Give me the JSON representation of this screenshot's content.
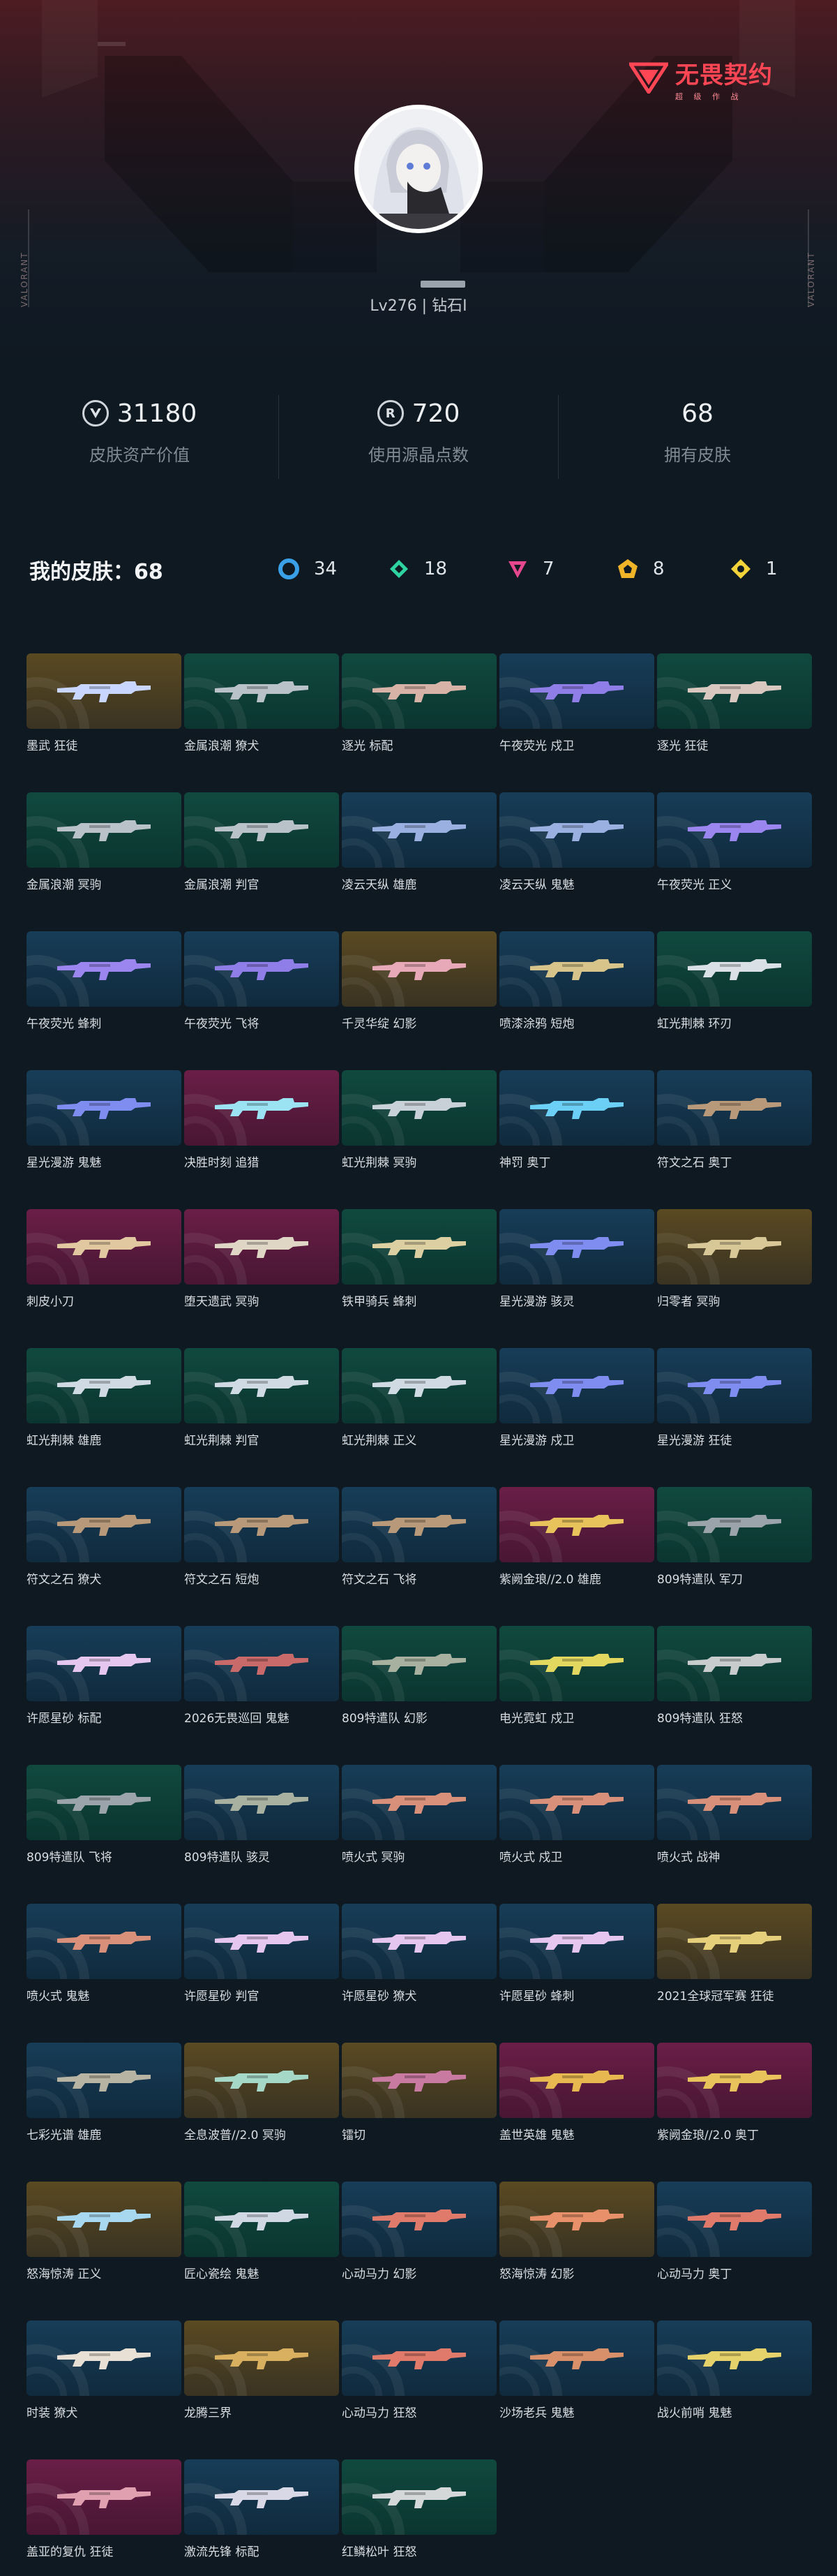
{
  "header": {
    "logo_title": "无畏契约",
    "logo_subtitle": "超 级 作 战",
    "side_left": "VALORANT",
    "side_right": "VALORANT",
    "level_text": "Lv276 | 钻石I"
  },
  "stats": [
    {
      "value": "31180",
      "label": "皮肤资产价值",
      "icon": "valorant-points-icon"
    },
    {
      "value": "720",
      "label": "使用源晶点数",
      "icon": "radianite-icon"
    },
    {
      "value": "68",
      "label": "拥有皮肤",
      "icon": ""
    }
  ],
  "summary": {
    "title": "我的皮肤：68",
    "tiers": [
      {
        "icon": "select-tier-icon",
        "color": "#3aa0e8",
        "count": "34"
      },
      {
        "icon": "deluxe-tier-icon",
        "color": "#2ed3a0",
        "count": "18"
      },
      {
        "icon": "premium-tier-icon",
        "color": "#e6488f",
        "count": "7"
      },
      {
        "icon": "ultra-tier-icon",
        "color": "#f0b429",
        "count": "8"
      },
      {
        "icon": "exclusive-tier-icon",
        "color": "#f2d33a",
        "count": "1"
      }
    ]
  },
  "skins": [
    {
      "name": "墨武 狂徒",
      "tier": "gold",
      "gun_color": "#c9d6ff"
    },
    {
      "name": "金属浪潮 獠犬",
      "tier": "green",
      "gun_color": "#b8c2c8"
    },
    {
      "name": "逐光 标配",
      "tier": "green",
      "gun_color": "#d7b2a6"
    },
    {
      "name": "午夜荧光 戍卫",
      "tier": "blue",
      "gun_color": "#8f7ee8"
    },
    {
      "name": "逐光 狂徒",
      "tier": "green",
      "gun_color": "#d8c8c0"
    },
    {
      "name": "金属浪潮 冥驹",
      "tier": "green",
      "gun_color": "#b8c2c8"
    },
    {
      "name": "金属浪潮 判官",
      "tier": "green",
      "gun_color": "#b8c2c8"
    },
    {
      "name": "凌云天纵 雄鹿",
      "tier": "blue",
      "gun_color": "#9ab0e0"
    },
    {
      "name": "凌云天纵 鬼魅",
      "tier": "blue",
      "gun_color": "#9ab0e0"
    },
    {
      "name": "午夜荧光 正义",
      "tier": "blue",
      "gun_color": "#9b86f0"
    },
    {
      "name": "午夜荧光 蜂刺",
      "tier": "blue",
      "gun_color": "#9b86f0"
    },
    {
      "name": "午夜荧光 飞将",
      "tier": "blue",
      "gun_color": "#8f7ee8"
    },
    {
      "name": "千灵华绽 幻影",
      "tier": "gold",
      "gun_color": "#e7a8b8"
    },
    {
      "name": "喷漆涂鸦 短炮",
      "tier": "blue",
      "gun_color": "#d6c48a"
    },
    {
      "name": "虹光荆棘 环刃",
      "tier": "green",
      "gun_color": "#d9e0e6"
    },
    {
      "name": "星光漫游 鬼魅",
      "tier": "blue",
      "gun_color": "#7f8cf0"
    },
    {
      "name": "决胜时刻 追猎",
      "tier": "pink",
      "gun_color": "#9be3f2"
    },
    {
      "name": "虹光荆棘 冥驹",
      "tier": "green",
      "gun_color": "#c8d0d8"
    },
    {
      "name": "神罚 奥丁",
      "tier": "blue",
      "gun_color": "#6ccff5"
    },
    {
      "name": "符文之石 奥丁",
      "tier": "blue",
      "gun_color": "#b89a7a"
    },
    {
      "name": "刺皮小刀",
      "tier": "pink",
      "gun_color": "#e2c8a0"
    },
    {
      "name": "堕天遗武 冥驹",
      "tier": "pink",
      "gun_color": "#e0d6c6"
    },
    {
      "name": "铁甲骑兵 蜂刺",
      "tier": "green",
      "gun_color": "#dccfa2"
    },
    {
      "name": "星光漫游 骇灵",
      "tier": "blue",
      "gun_color": "#7f8cf0"
    },
    {
      "name": "归零者 冥驹",
      "tier": "gold",
      "gun_color": "#d8c898"
    },
    {
      "name": "虹光荆棘 雄鹿",
      "tier": "green",
      "gun_color": "#d0dae2"
    },
    {
      "name": "虹光荆棘 判官",
      "tier": "green",
      "gun_color": "#d0dae2"
    },
    {
      "name": "虹光荆棘 正义",
      "tier": "green",
      "gun_color": "#d0dae2"
    },
    {
      "name": "星光漫游 戍卫",
      "tier": "blue",
      "gun_color": "#7f8cf0"
    },
    {
      "name": "星光漫游 狂徒",
      "tier": "blue",
      "gun_color": "#7f8cf0"
    },
    {
      "name": "符文之石 獠犬",
      "tier": "blue",
      "gun_color": "#b89a7a"
    },
    {
      "name": "符文之石 短炮",
      "tier": "blue",
      "gun_color": "#b89a7a"
    },
    {
      "name": "符文之石 飞将",
      "tier": "blue",
      "gun_color": "#b89a7a"
    },
    {
      "name": "紫阙金琅//2.0 雄鹿",
      "tier": "pink",
      "gun_color": "#e8c25a"
    },
    {
      "name": "809特遣队 军刀",
      "tier": "green",
      "gun_color": "#9aa4aa"
    },
    {
      "name": "许愿星砂 标配",
      "tier": "blue",
      "gun_color": "#e4c6ee"
    },
    {
      "name": "2026无畏巡回 鬼魅",
      "tier": "blue",
      "gun_color": "#c86a6a"
    },
    {
      "name": "809特遣队 幻影",
      "tier": "green",
      "gun_color": "#a8b0a0"
    },
    {
      "name": "电光霓虹 戍卫",
      "tier": "green",
      "gun_color": "#e2d860"
    },
    {
      "name": "809特遣队 狂怒",
      "tier": "green",
      "gun_color": "#c8cccc"
    },
    {
      "name": "809特遣队 飞将",
      "tier": "green",
      "gun_color": "#9aa4aa"
    },
    {
      "name": "809特遣队 骇灵",
      "tier": "blue",
      "gun_color": "#a8b0a0"
    },
    {
      "name": "喷火式 冥驹",
      "tier": "blue",
      "gun_color": "#d8907a"
    },
    {
      "name": "喷火式 戍卫",
      "tier": "blue",
      "gun_color": "#d8907a"
    },
    {
      "name": "喷火式 战神",
      "tier": "blue",
      "gun_color": "#d8907a"
    },
    {
      "name": "喷火式 鬼魅",
      "tier": "blue",
      "gun_color": "#d8907a"
    },
    {
      "name": "许愿星砂 判官",
      "tier": "blue",
      "gun_color": "#e4c6ee"
    },
    {
      "name": "许愿星砂 獠犬",
      "tier": "blue",
      "gun_color": "#e4c6ee"
    },
    {
      "name": "许愿星砂 蜂刺",
      "tier": "blue",
      "gun_color": "#e4c6ee"
    },
    {
      "name": "2021全球冠军赛 狂徒",
      "tier": "gold",
      "gun_color": "#e6cf7a"
    },
    {
      "name": "七彩光谱 雄鹿",
      "tier": "blue",
      "gun_color": "#b8b4a4"
    },
    {
      "name": "全息波普//2.0 冥驹",
      "tier": "gold",
      "gun_color": "#a6d8c8"
    },
    {
      "name": "镭切",
      "tier": "gold",
      "gun_color": "#c87aa0"
    },
    {
      "name": "盖世英雄 鬼魅",
      "tier": "pink",
      "gun_color": "#e8b850"
    },
    {
      "name": "紫阙金琅//2.0 奥丁",
      "tier": "pink",
      "gun_color": "#e8c25a"
    },
    {
      "name": "怒海惊涛 正义",
      "tier": "gold",
      "gun_color": "#a8d8f0"
    },
    {
      "name": "匠心瓷绘 鬼魅",
      "tier": "green",
      "gun_color": "#d0d8e4"
    },
    {
      "name": "心动马力 幻影",
      "tier": "blue",
      "gun_color": "#e07a6a"
    },
    {
      "name": "怒海惊涛 幻影",
      "tier": "gold",
      "gun_color": "#e8906a"
    },
    {
      "name": "心动马力 奥丁",
      "tier": "blue",
      "gun_color": "#e07a6a"
    },
    {
      "name": "时装 獠犬",
      "tier": "blue",
      "gun_color": "#e8e0d4"
    },
    {
      "name": "龙腾三界",
      "tier": "gold",
      "gun_color": "#d8b060"
    },
    {
      "name": "心动马力 狂怒",
      "tier": "blue",
      "gun_color": "#e07a6a"
    },
    {
      "name": "沙场老兵 鬼魅",
      "tier": "blue",
      "gun_color": "#d8906a"
    },
    {
      "name": "战火前哨 鬼魅",
      "tier": "blue",
      "gun_color": "#e6d26a"
    },
    {
      "name": "盖亚的复仇 狂徒",
      "tier": "pink",
      "gun_color": "#e0a0b0"
    },
    {
      "name": "激流先锋 标配",
      "tier": "blue",
      "gun_color": "#d8d8e6"
    },
    {
      "name": "红鳞松叶 狂怒",
      "tier": "green",
      "gun_color": "#d4d8d8"
    }
  ]
}
